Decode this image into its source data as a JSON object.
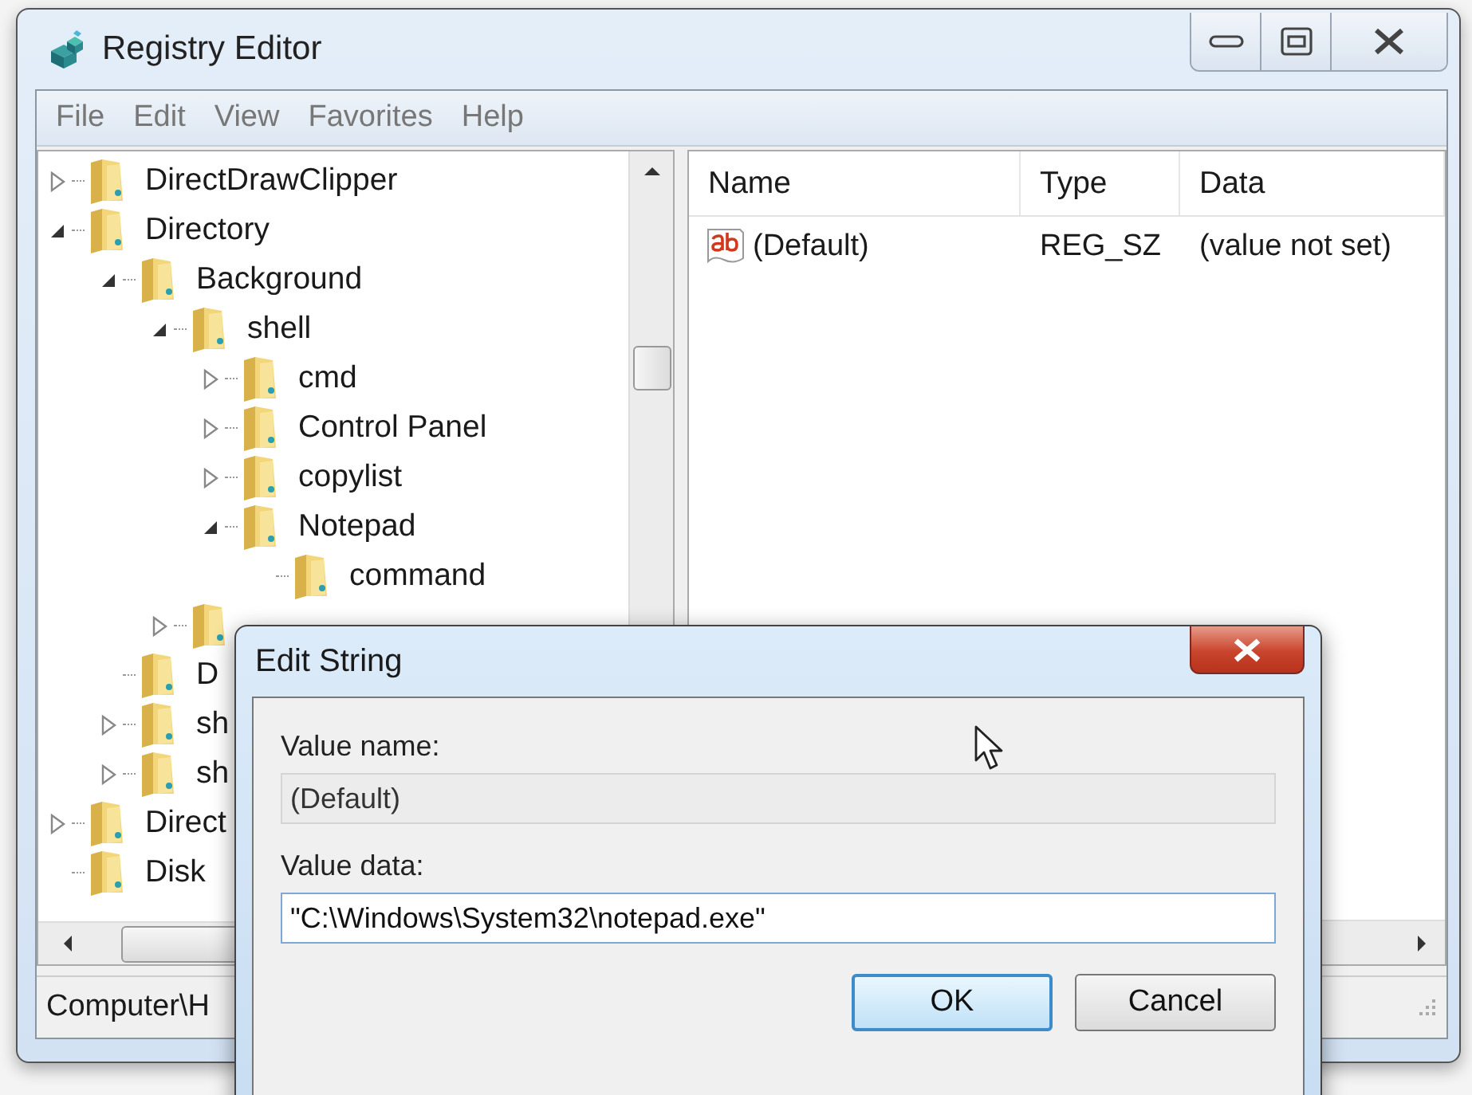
{
  "window": {
    "title": "Registry Editor"
  },
  "menu": [
    {
      "label": "File"
    },
    {
      "label": "Edit"
    },
    {
      "label": "View"
    },
    {
      "label": "Favorites"
    },
    {
      "label": "Help"
    }
  ],
  "tree": {
    "items": [
      {
        "label": "DirectDrawClipper",
        "expanded": false
      },
      {
        "label": "Directory",
        "expanded": true,
        "children": [
          {
            "label": "Background",
            "expanded": true,
            "children": [
              {
                "label": "shell",
                "expanded": true,
                "children": [
                  {
                    "label": "cmd",
                    "expanded": false
                  },
                  {
                    "label": "Control Panel",
                    "expanded": false
                  },
                  {
                    "label": "copylist",
                    "expanded": false
                  },
                  {
                    "label": "Notepad",
                    "expanded": true,
                    "children": [
                      {
                        "label": "command"
                      }
                    ]
                  }
                ]
              },
              {
                "expanded": false
              }
            ]
          },
          {
            "label": "D"
          },
          {
            "label": "sh",
            "expanded": false
          },
          {
            "label": "sh",
            "expanded": false
          }
        ]
      },
      {
        "label": "Direct",
        "expanded": false
      },
      {
        "label": "Disk"
      }
    ]
  },
  "values": {
    "columns": [
      "Name",
      "Type",
      "Data"
    ],
    "rows": [
      {
        "kind": "string",
        "name": "(Default)",
        "type": "REG_SZ",
        "data": "(value not set)"
      }
    ]
  },
  "status_bar": "Computer\\H",
  "dialog": {
    "title": "Edit String",
    "value_name_label": "Value name:",
    "value_name": "(Default)",
    "value_data_label": "Value data:",
    "value_data": "\"C:\\Windows\\System32\\notepad.exe\"",
    "buttons": [
      {
        "label": "OK",
        "kind": "default"
      },
      {
        "label": "Cancel",
        "kind": "normal"
      }
    ]
  }
}
